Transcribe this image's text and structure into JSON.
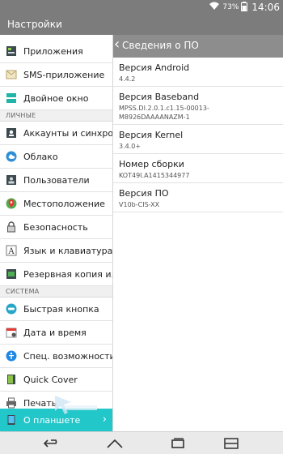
{
  "status": {
    "battery_pct": "73%",
    "time": "14:06"
  },
  "app": {
    "title": "Настройки"
  },
  "left_panel": {
    "items": [
      {
        "label": "Приложения",
        "icon": "apps-icon"
      },
      {
        "label": "SMS-приложение",
        "icon": "sms-icon"
      },
      {
        "label": "Двойное окно",
        "icon": "dual-window-icon"
      },
      {
        "label": "Аккаунты и синхро",
        "icon": "accounts-icon"
      },
      {
        "label": "Облако",
        "icon": "cloud-icon"
      },
      {
        "label": "Пользователи",
        "icon": "users-icon"
      },
      {
        "label": "Местоположение",
        "icon": "location-icon"
      },
      {
        "label": "Безопасность",
        "icon": "lock-icon"
      },
      {
        "label": "Язык и клавиатура",
        "icon": "language-icon"
      },
      {
        "label": "Резервная копия и...",
        "icon": "backup-icon"
      },
      {
        "label": "Быстрая кнопка",
        "icon": "quick-button-icon"
      },
      {
        "label": "Дата и время",
        "icon": "calendar-icon"
      },
      {
        "label": "Спец. возможности",
        "icon": "accessibility-icon"
      },
      {
        "label": "Quick Cover",
        "icon": "quick-cover-icon"
      },
      {
        "label": "Печать",
        "icon": "print-icon"
      },
      {
        "label": "О планшете",
        "icon": "tablet-icon"
      }
    ],
    "sections": {
      "personal": "ЛИЧНЫЕ",
      "system": "СИСТЕМА"
    }
  },
  "right_panel": {
    "title": "Сведения о ПО",
    "items": [
      {
        "title": "Версия Android",
        "value": "4.4.2"
      },
      {
        "title": "Версия Baseband",
        "value": "MPSS.DI.2.0.1.c1.15-00013-M8926DAAAANAZM-1"
      },
      {
        "title": "Версия Kernel",
        "value": "3.4.0+"
      },
      {
        "title": "Номер сборки",
        "value": "KOT49I.A1415344977"
      },
      {
        "title": "Версия ПО",
        "value": "V10b-CIS-XX"
      }
    ]
  },
  "navigation": {
    "back": "back-icon",
    "home": "home-icon",
    "recents": "recents-icon",
    "menu": "dual-window-icon"
  }
}
